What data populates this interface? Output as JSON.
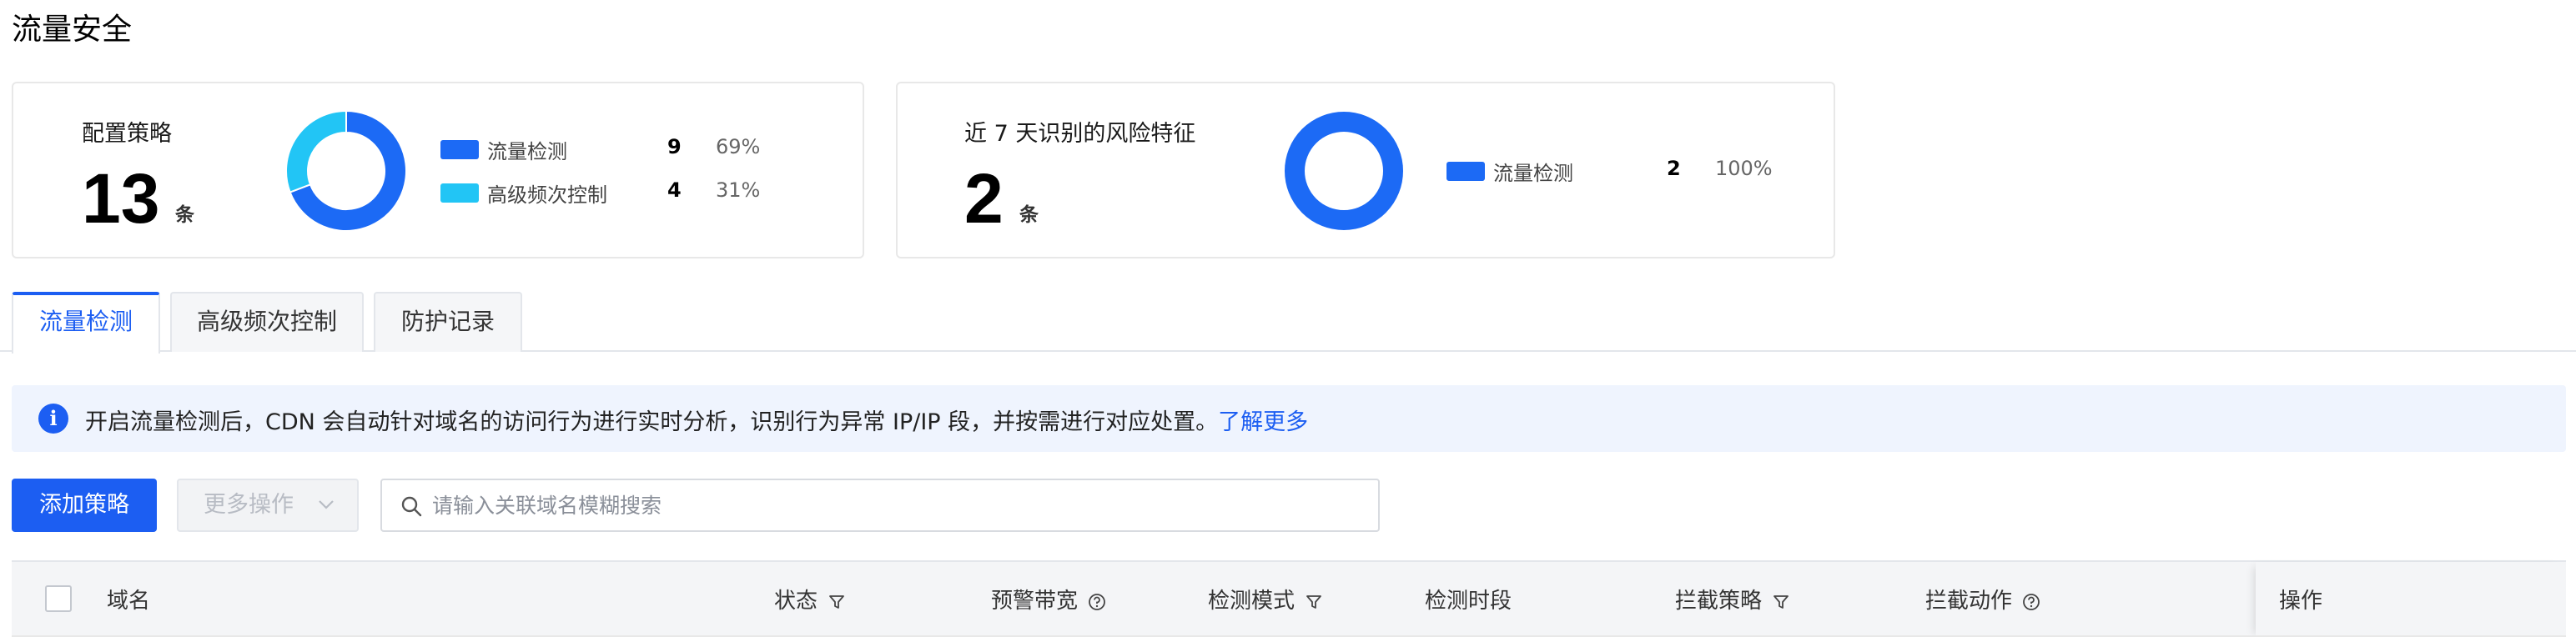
{
  "page": {
    "title": "流量安全"
  },
  "cards": [
    {
      "label": "配置策略",
      "value": "13",
      "unit": "条",
      "legend": [
        {
          "label": "流量检测",
          "count": "9",
          "pct": "69%",
          "color": "#1c6af5"
        },
        {
          "label": "高级频次控制",
          "count": "4",
          "pct": "31%",
          "color": "#22c5f5"
        }
      ]
    },
    {
      "label": "近 7 天识别的风险特征",
      "value": "2",
      "unit": "条",
      "legend": [
        {
          "label": "流量检测",
          "count": "2",
          "pct": "100%",
          "color": "#1c6af5"
        }
      ]
    }
  ],
  "chart_data": [
    {
      "type": "pie",
      "categories": [
        "流量检测",
        "高级频次控制"
      ],
      "values": [
        9,
        4
      ]
    },
    {
      "type": "pie",
      "categories": [
        "流量检测"
      ],
      "values": [
        2
      ]
    }
  ],
  "tabs": [
    {
      "label": "流量检测",
      "active": true
    },
    {
      "label": "高级频次控制",
      "active": false
    },
    {
      "label": "防护记录",
      "active": false
    }
  ],
  "info": {
    "text": "开启流量检测后，CDN 会自动针对域名的访问行为进行实时分析，识别行为异常 IP/IP 段，并按需进行对应处置。",
    "link": "了解更多"
  },
  "toolbar": {
    "add_label": "添加策略",
    "more_label": "更多操作",
    "search_placeholder": "请输入关联域名模糊搜索"
  },
  "table": {
    "columns": [
      "域名",
      "状态",
      "预警带宽",
      "检测模式",
      "检测时段",
      "拦截策略",
      "拦截动作",
      "操作"
    ]
  },
  "colors": {
    "accent": "#1c5ef2",
    "secondary": "#22c5f5"
  }
}
